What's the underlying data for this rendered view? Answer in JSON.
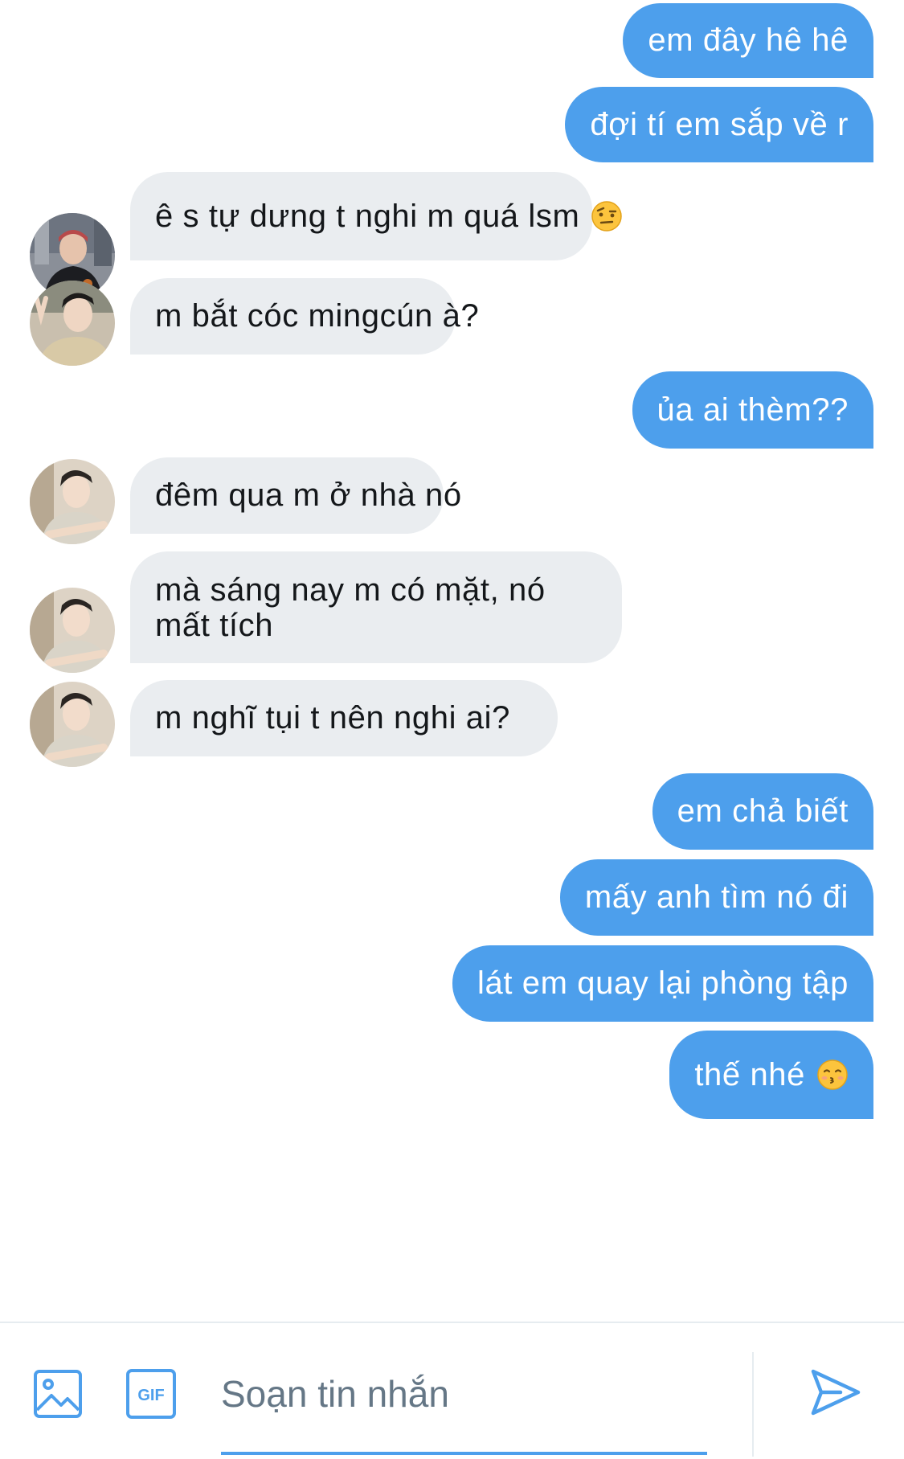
{
  "accent_color": "#4d9fec",
  "messages": [
    {
      "side": "sent",
      "text": "em đây hê hê"
    },
    {
      "side": "sent",
      "text": "đợi tí em sắp về r"
    },
    {
      "side": "received",
      "text": "ê s tự dưng t nghi m quá lsm",
      "emoji": "raised-eyebrow-emoji"
    },
    {
      "side": "received",
      "text": "m bắt cóc mingcún à?"
    },
    {
      "side": "sent",
      "text": "ủa ai thèm??"
    },
    {
      "side": "received",
      "text": "đêm qua m ở nhà nó"
    },
    {
      "side": "received",
      "text": "mà sáng nay m có mặt, nó mất tích"
    },
    {
      "side": "received",
      "text": "m nghĩ tụi t nên nghi ai?"
    },
    {
      "side": "sent",
      "text": "em chả biết"
    },
    {
      "side": "sent",
      "text": "mấy anh tìm nó đi"
    },
    {
      "side": "sent",
      "text": "lát em quay lại phòng tập"
    },
    {
      "side": "sent",
      "text": "thế nhé",
      "emoji": "kissing-emoji"
    }
  ],
  "composer": {
    "placeholder": "Soạn tin nhắn",
    "media_icon": "image-icon",
    "gif_icon": "gif-icon",
    "gif_label": "GIF",
    "send_icon": "send-icon"
  }
}
